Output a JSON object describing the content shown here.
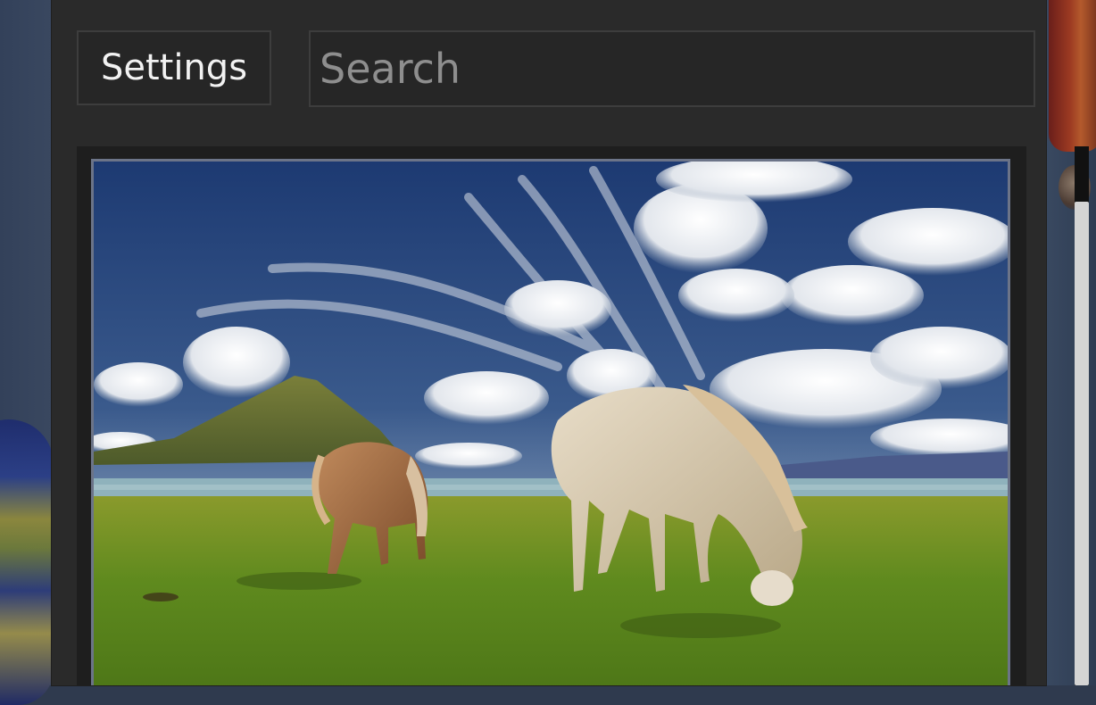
{
  "toolbar": {
    "settings_label": "Settings",
    "search_placeholder": "Search",
    "search_value": ""
  },
  "viewer": {
    "image_subject": "landscape-photo-horses"
  },
  "colors": {
    "panel_bg": "#2a2a2a",
    "control_bg": "#262626",
    "control_border": "#3d3d3d",
    "frame_border": "#6c7488",
    "scroll_thumb": "#d4d4d4",
    "scroll_track": "#111111"
  }
}
